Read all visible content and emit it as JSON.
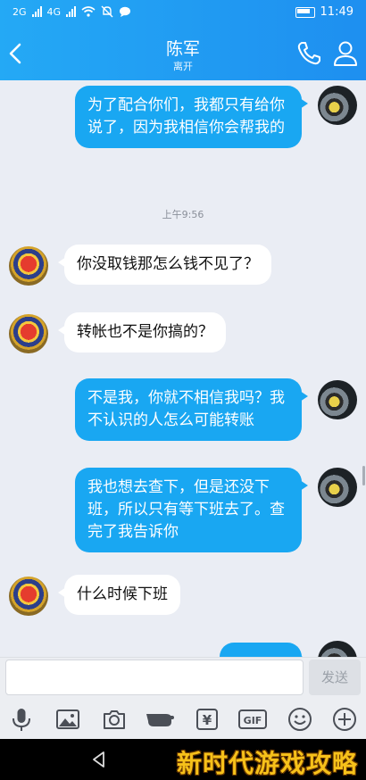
{
  "status_bar": {
    "network_1": "2G",
    "network_2": "4G",
    "time": "11:49"
  },
  "header": {
    "title": "陈军",
    "subtitle": "离开"
  },
  "messages": [
    {
      "from": "self",
      "text": "为了配合你们，我都只有给你说了，因为我相信你会帮我的"
    },
    {
      "from": "police",
      "text": "你没取钱那怎么钱不见了？"
    },
    {
      "from": "police",
      "text": "转帐也不是你搞的？"
    },
    {
      "from": "self",
      "text": "不是我，你就不相信我吗？我不认识的人怎么可能转账"
    },
    {
      "from": "self",
      "text": "我也想去查下，但是还没下班，所以只有等下班去了。查完了我告诉你"
    },
    {
      "from": "police",
      "text": "什么时候下班"
    }
  ],
  "timestamp": "上午9:56",
  "input": {
    "placeholder": "",
    "send_label": "发送"
  },
  "toolbar": {
    "icons": [
      "mic-icon",
      "image-icon",
      "camera-icon",
      "hongbao-icon",
      "transfer-icon",
      "gif-icon",
      "emoji-icon",
      "plus-icon"
    ],
    "gif_label": "GIF",
    "transfer_label": "¥"
  },
  "watermark": "新时代游戏攻略",
  "colors": {
    "header_blue": "#1e8ff0",
    "outgoing_bubble": "#19a7f2",
    "incoming_bubble": "#ffffff",
    "chat_background": "#eaedf4"
  }
}
